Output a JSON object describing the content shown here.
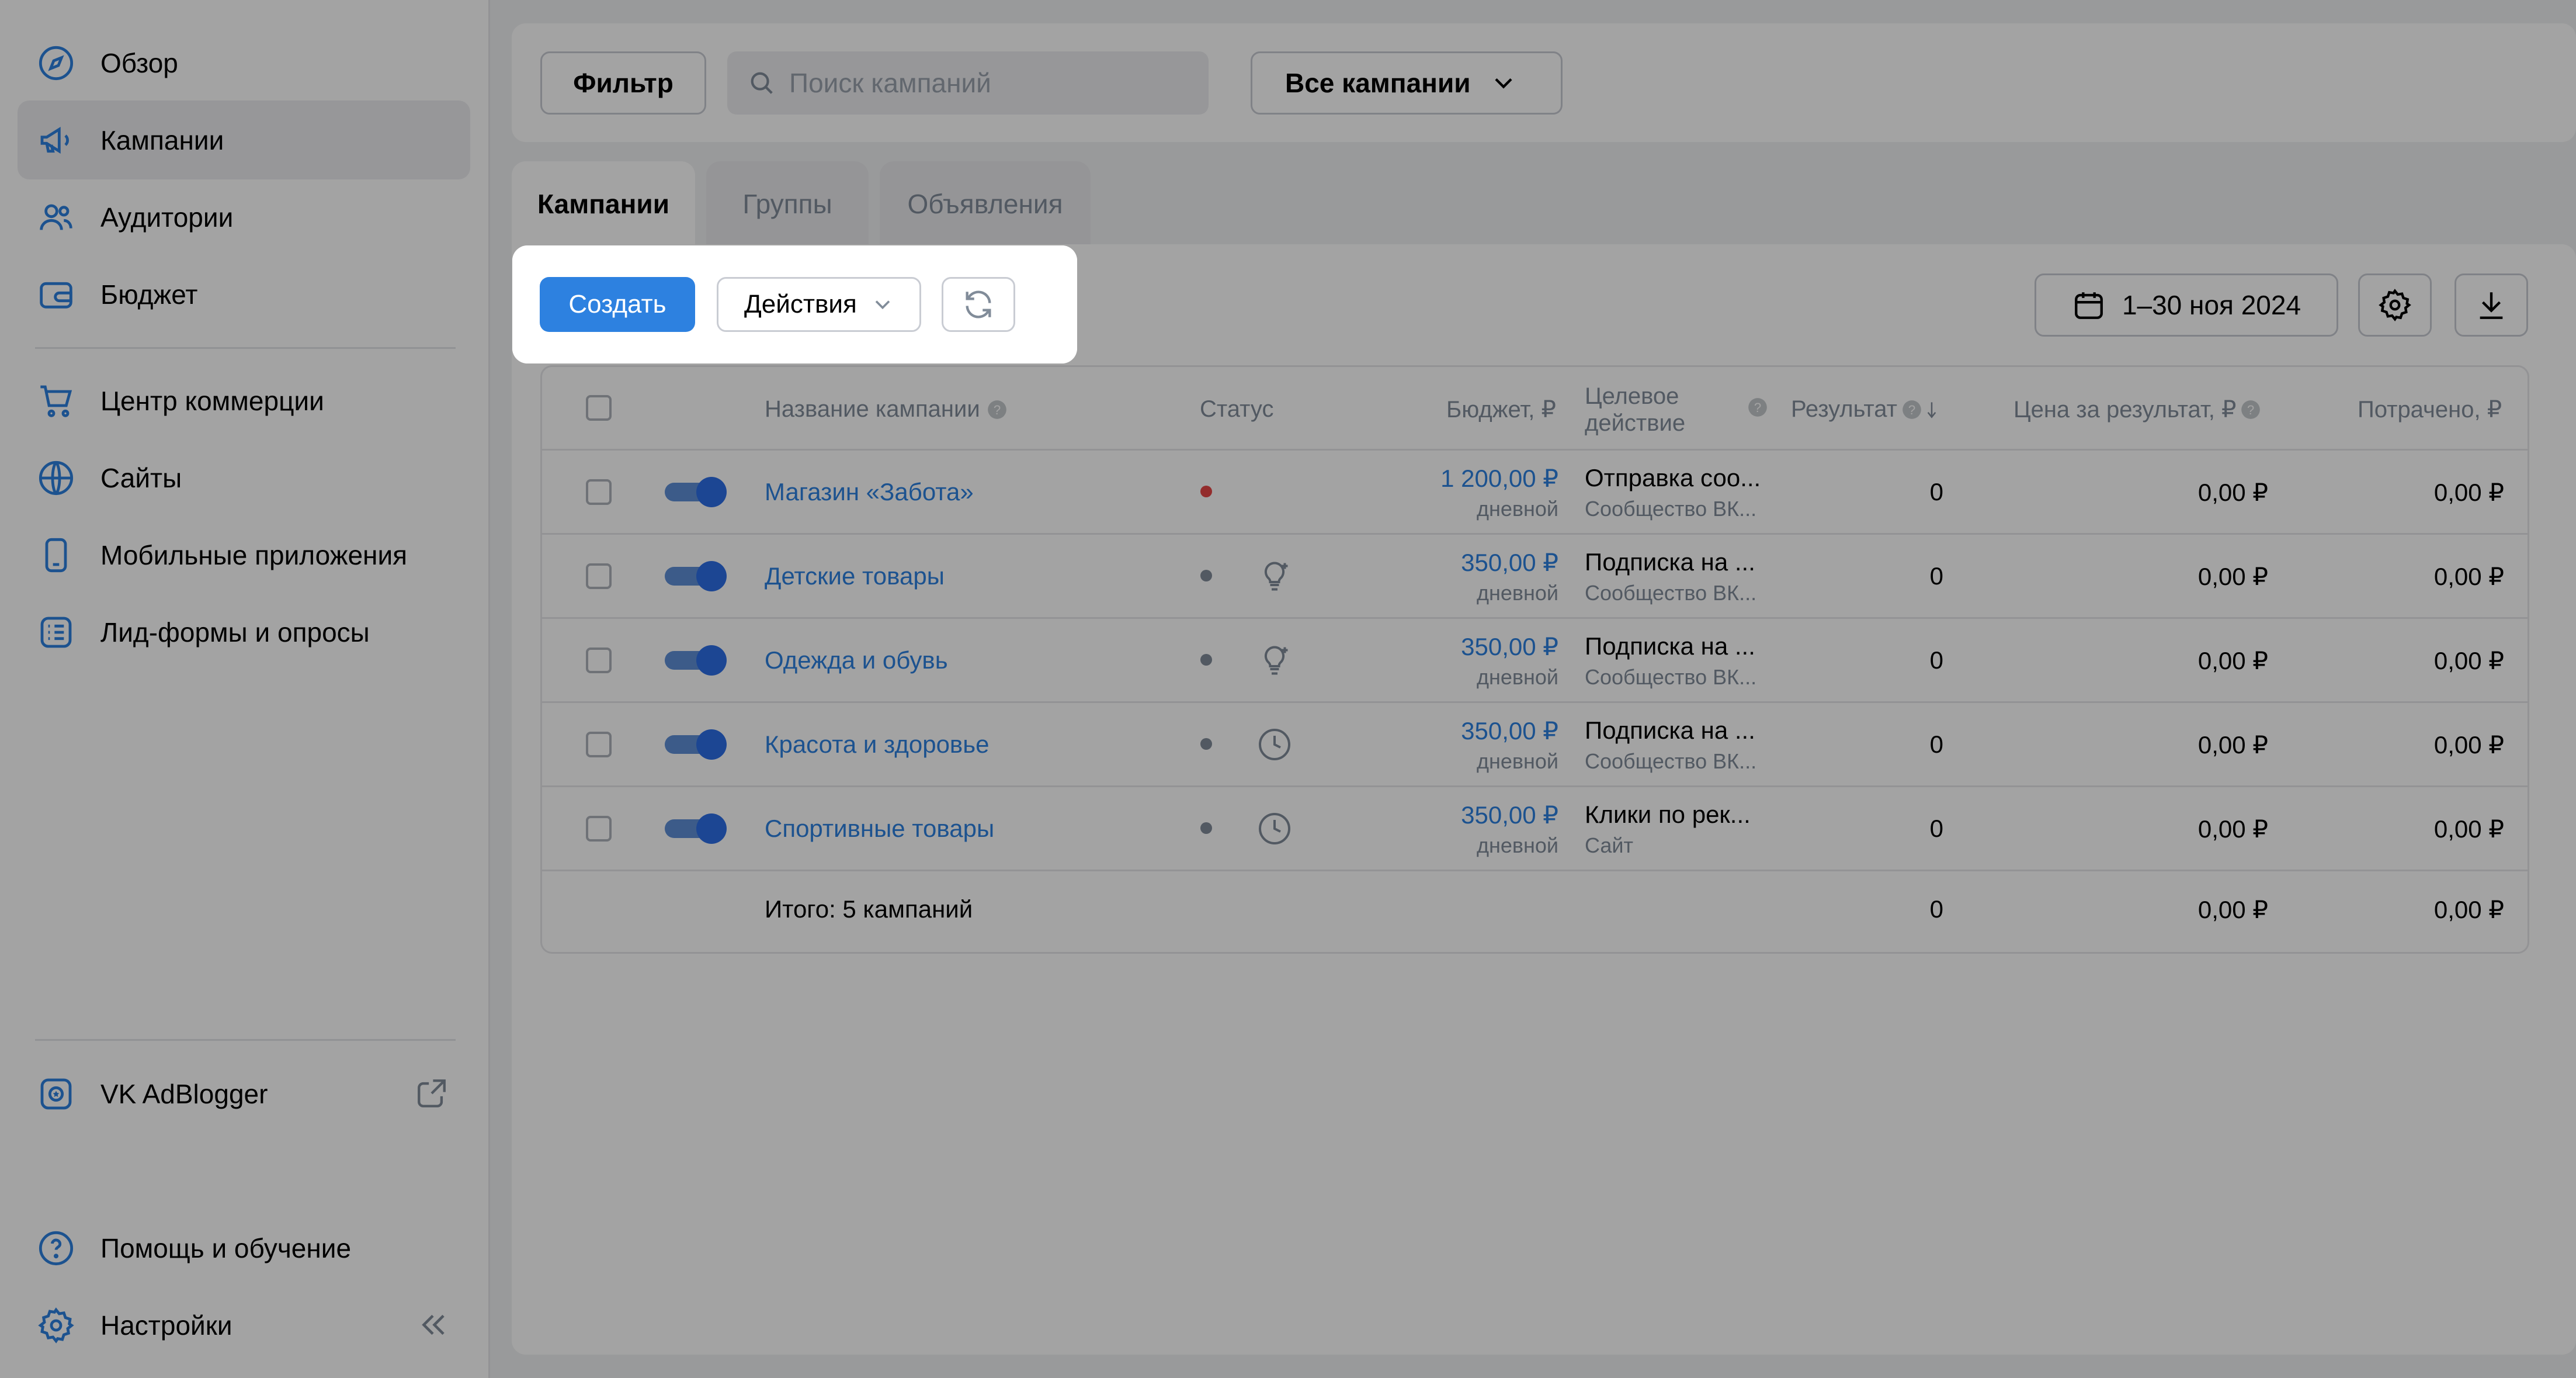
{
  "sidebar": {
    "items": [
      {
        "label": "Обзор",
        "icon": "compass-icon"
      },
      {
        "label": "Кампании",
        "icon": "megaphone-icon"
      },
      {
        "label": "Аудитории",
        "icon": "users-icon"
      },
      {
        "label": "Бюджет",
        "icon": "wallet-icon"
      },
      {
        "label": "Центр коммерции",
        "icon": "cart-icon"
      },
      {
        "label": "Сайты",
        "icon": "globe-icon"
      },
      {
        "label": "Мобильные приложения",
        "icon": "smartphone-icon"
      },
      {
        "label": "Лид-формы и опросы",
        "icon": "list-form-icon"
      }
    ],
    "adblogger": {
      "label": "VK AdBlogger",
      "icon": "adblogger-icon",
      "ext_icon": "external-link-icon"
    },
    "help": {
      "label": "Помощь и обучение",
      "icon": "help-circle-icon"
    },
    "settings": {
      "label": "Настройки",
      "icon": "gear-icon",
      "collapse_icon": "chevrons-left-icon"
    }
  },
  "topbar": {
    "filter_label": "Фильтр",
    "search_placeholder": "Поиск кампаний",
    "campaigns_select": "Все кампании"
  },
  "tabs": [
    {
      "label": "Кампании",
      "active": true
    },
    {
      "label": "Группы",
      "active": false
    },
    {
      "label": "Объявления",
      "active": false
    }
  ],
  "toolbar": {
    "create_label": "Создать",
    "actions_label": "Действия",
    "date_range": "1–30 ноя 2024"
  },
  "table": {
    "headers": {
      "name": "Название кампании",
      "status": "Статус",
      "budget": "Бюджет, ₽",
      "target_line1": "Целевое",
      "target_line2": "действие",
      "result": "Результат",
      "price": "Цена за результат, ₽",
      "spent": "Потрачено, ₽"
    },
    "rows": [
      {
        "name": "Магазин «Забота»",
        "budget": "1 200,00 ₽",
        "budget_type": "дневной",
        "action": "Отправка соо...",
        "action_sub": "Сообщество ВК...",
        "result": "0",
        "price": "0,00 ₽",
        "spent": "0,00 ₽",
        "status_color": "#e64646",
        "status_icon": ""
      },
      {
        "name": "Детские товары",
        "budget": "350,00 ₽",
        "budget_type": "дневной",
        "action": "Подписка на ...",
        "action_sub": "Сообщество ВК...",
        "result": "0",
        "price": "0,00 ₽",
        "spent": "0,00 ₽",
        "status_color": "#818c99",
        "status_icon": "lightbulb-icon"
      },
      {
        "name": "Одежда и обувь",
        "budget": "350,00 ₽",
        "budget_type": "дневной",
        "action": "Подписка на ...",
        "action_sub": "Сообщество ВК...",
        "result": "0",
        "price": "0,00 ₽",
        "spent": "0,00 ₽",
        "status_color": "#818c99",
        "status_icon": "lightbulb-icon"
      },
      {
        "name": "Красота и здоровье",
        "budget": "350,00 ₽",
        "budget_type": "дневной",
        "action": "Подписка на ...",
        "action_sub": "Сообщество ВК...",
        "result": "0",
        "price": "0,00 ₽",
        "spent": "0,00 ₽",
        "status_color": "#818c99",
        "status_icon": "clock-icon"
      },
      {
        "name": "Спортивные товары",
        "budget": "350,00 ₽",
        "budget_type": "дневной",
        "action": "Клики по рек...",
        "action_sub": "Сайт",
        "result": "0",
        "price": "0,00 ₽",
        "spent": "0,00 ₽",
        "status_color": "#818c99",
        "status_icon": "clock-icon"
      }
    ],
    "total": {
      "label": "Итого: 5 кампаний",
      "result": "0",
      "price": "0,00 ₽",
      "spent": "0,00 ₽"
    }
  },
  "colors": {
    "accent": "#2d81e0",
    "overlay": "rgba(0,0,0,0.35)"
  }
}
